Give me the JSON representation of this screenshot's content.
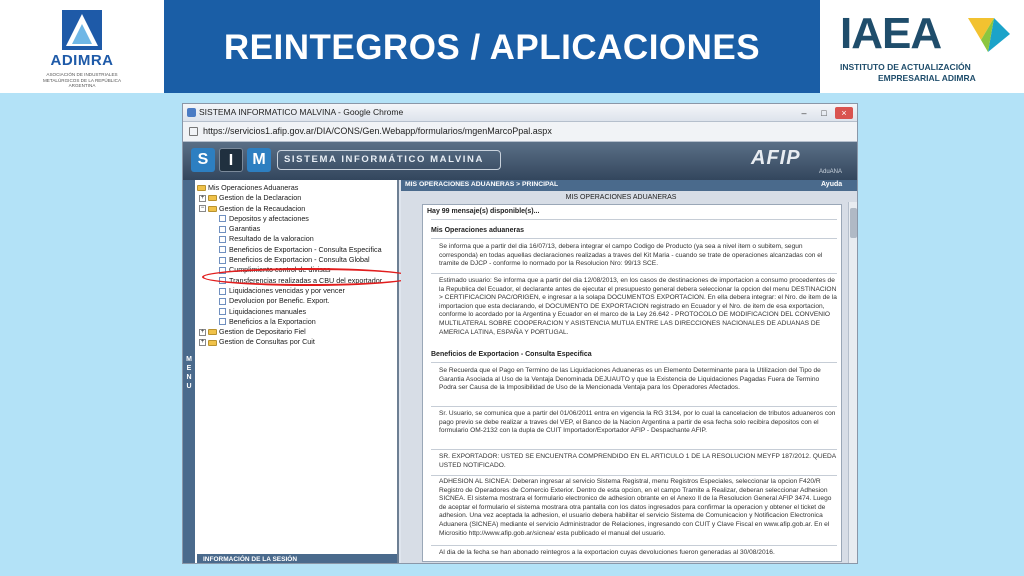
{
  "slide": {
    "title": "REINTEGROS / APLICACIONES",
    "left_logo": {
      "name": "ADIMRA",
      "subtitle": "ASOCIACIÓN DE INDUSTRIALES METALÚRGICOS DE LA REPÚBLICA ARGENTINA"
    },
    "right_logo": {
      "name": "IAEA",
      "subtitle_line1": "INSTITUTO DE ACTUALIZACIÓN",
      "subtitle_line2": "EMPRESARIAL ADIMRA"
    },
    "colors": {
      "title_bar": "#1a5ea6",
      "background": "#b3e2f7",
      "highlight": "#e11d1d"
    }
  },
  "browser": {
    "window_title": "SISTEMA INFORMATICO MALVINA - Google Chrome",
    "url": "https://servicios1.afip.gov.ar/DIA/CONS/Gen.Webapp/formularios/mgenMarcoPpal.aspx",
    "window_buttons": {
      "minimize": "–",
      "maximize": "□",
      "close": "×"
    }
  },
  "app": {
    "letters": [
      "S",
      "I",
      "M"
    ],
    "name": "SISTEMA INFORMÁTICO MALVINA",
    "brand": "AFIP",
    "brand_sub": "AduANA",
    "menu_label": "MENU",
    "tree": [
      {
        "label": "Mis Operaciones Aduaneras",
        "level": 0,
        "type": "folder"
      },
      {
        "label": "Gestion de la Declaracion",
        "level": 1,
        "type": "folder-plus"
      },
      {
        "label": "Gestion de la Recaudacion",
        "level": 1,
        "type": "folder-plus"
      },
      {
        "label": "Depositos y afectaciones",
        "level": 2,
        "type": "doc"
      },
      {
        "label": "Garantias",
        "level": 2,
        "type": "doc"
      },
      {
        "label": "Resultado de la valoracion",
        "level": 2,
        "type": "doc"
      },
      {
        "label": "Beneficios de Exportacion - Consulta Especifica",
        "level": 2,
        "type": "doc"
      },
      {
        "label": "Beneficios de Exportacion - Consulta Global",
        "level": 2,
        "type": "doc"
      },
      {
        "label": "Cumplimiento control de divisas",
        "level": 2,
        "type": "doc"
      },
      {
        "label": "Transferencias realizadas a CBU del exportador",
        "level": 2,
        "type": "doc"
      },
      {
        "label": "Liquidaciones vencidas y por vencer",
        "level": 2,
        "type": "doc"
      },
      {
        "label": "Devolucion por Benefic. Export.",
        "level": 2,
        "type": "doc"
      },
      {
        "label": "Liquidaciones manuales",
        "level": 2,
        "type": "doc"
      },
      {
        "label": "Beneficios a la Exportacion",
        "level": 2,
        "type": "doc"
      },
      {
        "label": "Gestion de Depositario Fiel",
        "level": 1,
        "type": "folder-plus"
      },
      {
        "label": "Gestion de Consultas por Cuit",
        "level": 1,
        "type": "folder-plus"
      }
    ],
    "session_footer": "INFORMACIÓN DE LA SESIÓN",
    "content": {
      "breadcrumb": "MIS OPERACIONES ADUANERAS > PRINCIPAL",
      "help": "Ayuda",
      "panel_title": "MIS OPERACIONES ADUANERAS",
      "message_count": "Hay 99 mensaje(s) disponible(s)...",
      "section1": "Mis Operaciones aduaneras",
      "p1": "Se informa que a partir del dia 16/07/13, debera integrar el campo Codigo de Producto (ya sea a nivel item o subitem, segun corresponda) en todas aquellas declaraciones realizadas a traves del Kit Maria - cuando se trate de operaciones alcanzadas con el tramite de DJCP - conforme lo normado por la Resolucion Nro: 99/13 SCE.",
      "p2": "Estimado usuario: Se informa que a partir del dia 12/08/2013, en los casos de destinaciones de importacion a consumo procedentes de la Republica del Ecuador, el declarante antes de ejecutar el presupuesto general debera seleccionar la opcion del menu DESTINACION > CERTIFICACION PAC/ORIGEN, e ingresar a la solapa DOCUMENTOS EXPORTACION. En ella debera integrar: el Nro. de item de la importacion que esta declarando, el DOCUMENTO DE EXPORTACION registrado en Ecuador y el Nro. de item de esa exportacion, conforme lo acordado por la Argentina y Ecuador en el marco de la Ley 26.642 - PROTOCOLO DE MODIFICACION DEL CONVENIO MULTILATERAL SOBRE COOPERACION Y ASISTENCIA MUTUA ENTRE LAS DIRECCIONES NACIONALES DE ADUANAS DE AMERICA LATINA, ESPAÑA Y PORTUGAL.",
      "section2": "Beneficios de Exportacion - Consulta Especifica",
      "p3": "Se Recuerda que el Pago en Termino de las Liquidaciones Aduaneras es un Elemento Determinante para la Utilizacion del Tipo de Garantia Asociada al Uso de la Ventaja Denominada DEJUAUTO y que la Existencia de Liquidaciones Pagadas Fuera de Termino Podra ser Causa de la Imposibilidad de Uso de la Mencionada Ventaja para los Operadores Afectados.",
      "p4": "Sr. Usuario, se comunica que a partir del 01/06/2011 entra en vigencia la RG 3134, por lo cual la cancelacion de tributos aduaneros con pago previo se debe realizar a traves del VEP, el Banco de la Nacion Argentina a partir de esa fecha solo recibira depositos con el formulario OM-2132 con la dupla de CUIT Importador/Exportador AFIP - Despachante AFIP.",
      "p5": "SR. EXPORTADOR: USTED SE ENCUENTRA COMPRENDIDO EN EL ARTICULO 1 DE LA RESOLUCION MEYFP 187/2012. QUEDA USTED NOTIFICADO.",
      "p6": "ADHESION AL SICNEA: Deberan ingresar al servicio Sistema Registral, menu Registros Especiales, seleccionar la opcion F420/R Registro de Operadores de Comercio Exterior. Dentro de esta opcion, en el campo Tramite a Realizar, deberan seleccionar Adhesion SICNEA. El sistema mostrara el formulario electronico de adhesion obrante en el Anexo II de la Resolucion General AFIP 3474. Luego de aceptar el formulario el sistema mostrara otra pantalla con los datos ingresados para confirmar la operacion y obtener el ticket de adhesion. Una vez aceptada la adhesion, el usuario debera habilitar el servicio Sistema de Comunicacion y Notificacion Electronica Aduanera (SICNEA) mediante el servicio Administrador de Relaciones, ingresando con CUIT y Clave Fiscal en www.afip.gob.ar. En el Micrositio http://www.afip.gob.ar/sicnea/ esta publicado el manual del usuario.",
      "p7": "Al dia de la fecha se han abonado reintegros a la exportacion cuyas devoluciones fueron generadas al 30/08/2016."
    }
  }
}
